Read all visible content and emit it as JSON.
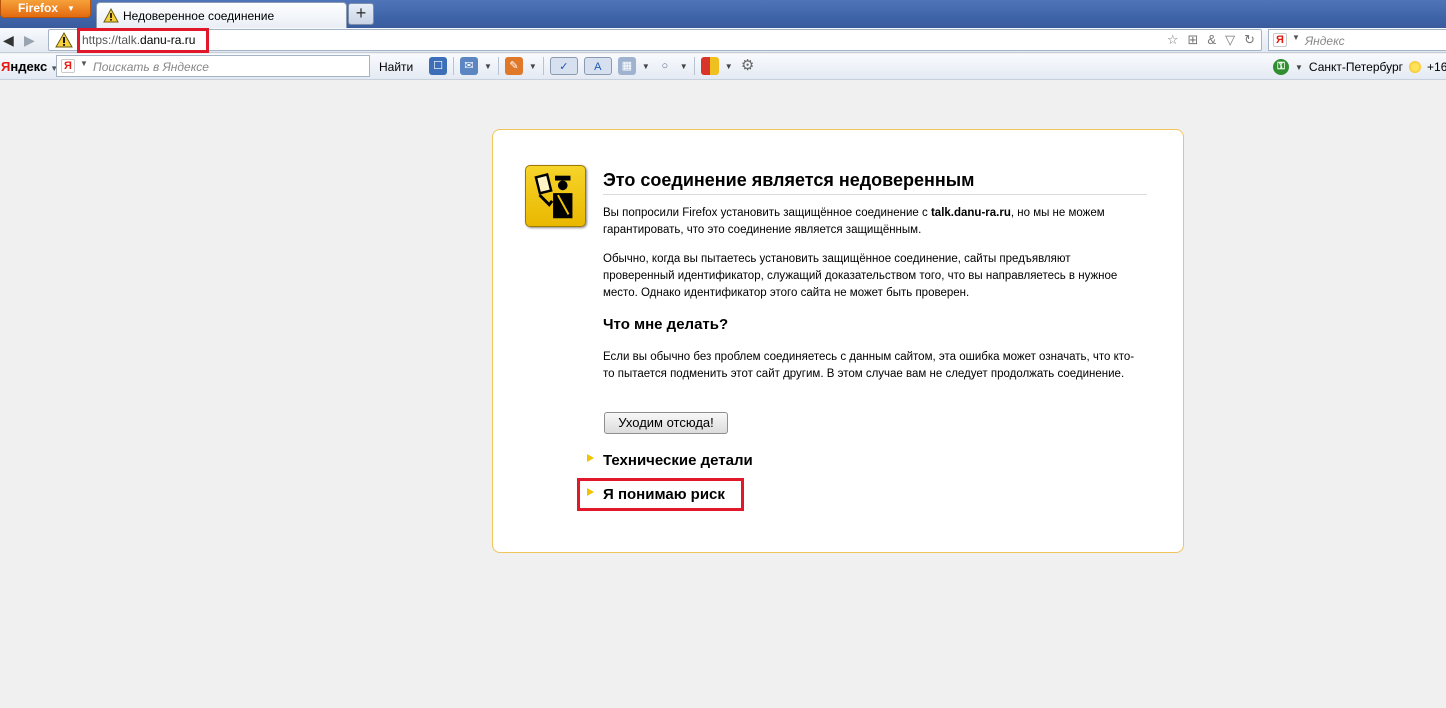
{
  "browser": {
    "menu_button": "Firefox",
    "tab": {
      "title": "Недоверенное соединение"
    },
    "new_tab": "+"
  },
  "navbar": {
    "url_scheme": "https://talk.",
    "url_host": "danu-ra.ru",
    "search_placeholder": "Яндекс"
  },
  "yandex_bar": {
    "logo_first": "Я",
    "logo_rest": "ндекс",
    "search_placeholder": "Поискать в Яндексе",
    "find_label": "Найти",
    "city": "Санкт-Петербург",
    "temperature": "+16"
  },
  "error_page": {
    "title": "Это соединение является недоверенным",
    "p1_before": "Вы попросили Firefox установить защищённое соединение с ",
    "p1_host": "talk.danu-ra.ru",
    "p1_after": ", но мы не можем гарантировать, что это соединение является защищённым.",
    "p2": "Обычно, когда вы пытаетесь установить защищённое соединение, сайты предъявляют проверенный идентификатор, служащий доказательством того, что вы направляетесь в нужное место. Однако идентификатор этого сайта не может быть проверен.",
    "what_to_do": "Что мне делать?",
    "p3": "Если вы обычно без проблем соединяетесь с данным сайтом, эта ошибка может означать, что кто-то пытается подменить этот сайт другим. В этом случае вам не следует продолжать соединение.",
    "leave_button": "Уходим отсюда!",
    "tech_details": "Технические детали",
    "understand_risk": "Я понимаю риск"
  },
  "colors": {
    "highlight": "#e0182a",
    "page_border": "#f0c35c",
    "ff_orange": "#e46a10"
  }
}
